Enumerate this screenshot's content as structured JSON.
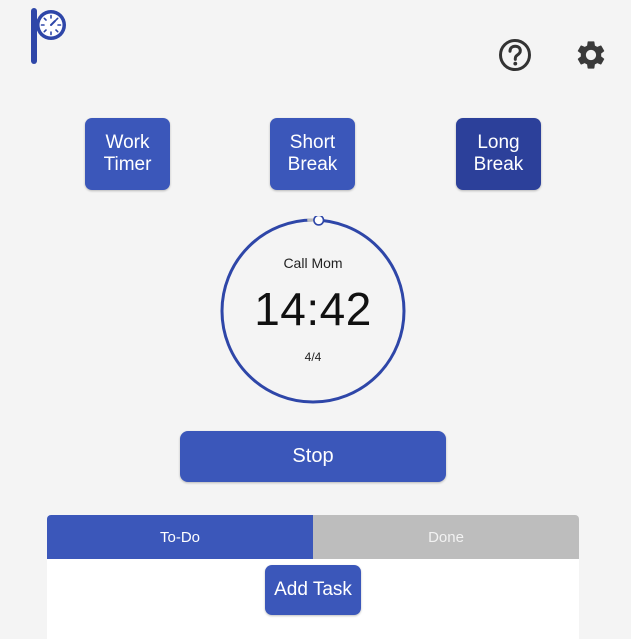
{
  "colors": {
    "accent": "#3b57ba",
    "accent_active": "#2c409a",
    "ring": "#2e46a8",
    "tab_inactive": "#bdbdbd",
    "background": "#f4f4f4"
  },
  "header": {
    "logo_icon": "pomodoro-clock-logo",
    "help_icon": "question-circle-icon",
    "settings_icon": "gear-icon"
  },
  "modes": {
    "work_label": "Work Timer",
    "short_label": "Short Break",
    "long_label": "Long Break",
    "selected": "long"
  },
  "timer": {
    "task_name": "Call Mom",
    "time": "14:42",
    "session": "4/4",
    "progress": 0.01
  },
  "controls": {
    "stop_label": "Stop"
  },
  "tasks": {
    "tab_todo": "To-Do",
    "tab_done": "Done",
    "active_tab": "todo",
    "add_label": "Add Task"
  }
}
